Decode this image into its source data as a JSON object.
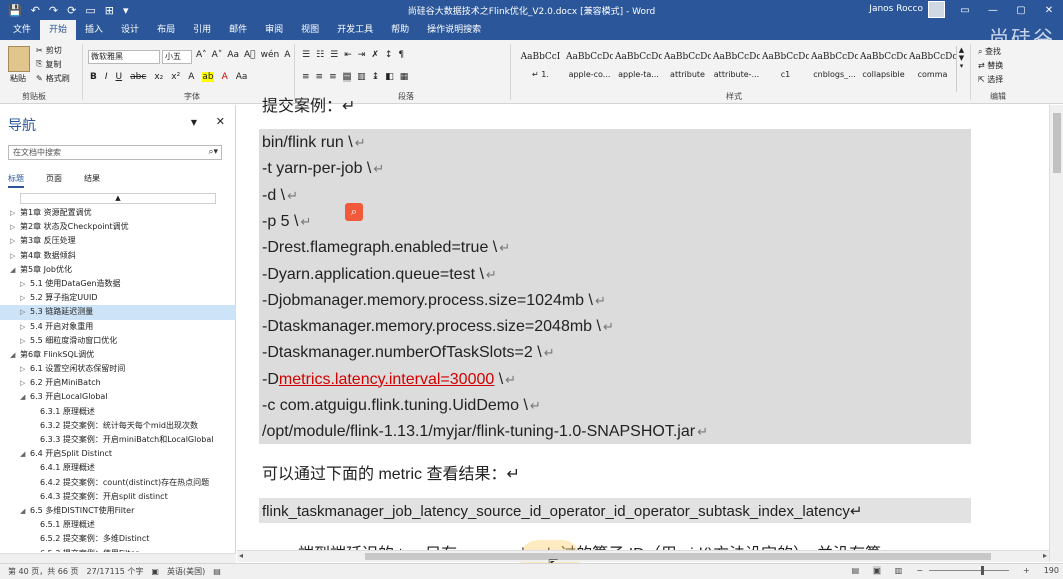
{
  "titlebar": {
    "title": "尚硅谷大数据技术之Flink优化_V2.0.docx [兼容模式] - Word",
    "user": "Janos Rocco",
    "qat": [
      "💾",
      "↶",
      "↷",
      "⟳",
      "▭",
      "⊞",
      "▾"
    ],
    "window_buttons": [
      "▭",
      "—",
      "▢",
      "✕"
    ]
  },
  "tabs": [
    "文件",
    "开始",
    "插入",
    "设计",
    "布局",
    "引用",
    "邮件",
    "审阅",
    "视图",
    "开发工具",
    "帮助",
    "操作说明搜索"
  ],
  "brand": "尚硅谷",
  "ribbon": {
    "clipboard": {
      "paste": "粘贴",
      "cut": "剪切",
      "copy": "复制",
      "format_painter": "格式刷",
      "label": "剪贴板"
    },
    "font": {
      "name": "微软雅黑",
      "size": "小五",
      "label": "字体",
      "row1": [
        "A˄",
        "A˅",
        "Aa",
        "A⃠",
        "wén",
        "A"
      ],
      "row2": [
        "B",
        "I",
        "U",
        "abc",
        "x₂",
        "x²",
        "A",
        "ab",
        "A",
        "Aa"
      ]
    },
    "paragraph": {
      "label": "段落",
      "row1": [
        "☰",
        "☷",
        "☰",
        "⇤",
        "⇥",
        "✗",
        "↕",
        "¶"
      ],
      "row2": [
        "≡",
        "≡",
        "≡",
        "▤",
        "▥",
        "↨",
        "◧",
        "▦"
      ]
    },
    "styles": {
      "label": "样式",
      "items": [
        {
          "sample": "AaBbCcI",
          "name": "↵ 1."
        },
        {
          "sample": "AaBbCcDc",
          "name": "apple-co..."
        },
        {
          "sample": "AaBbCcDc",
          "name": "apple-ta..."
        },
        {
          "sample": "AaBbCcDc",
          "name": "attribute"
        },
        {
          "sample": "AaBbCcDc",
          "name": "attribute-..."
        },
        {
          "sample": "AaBbCcDc",
          "name": "c1"
        },
        {
          "sample": "AaBbCcDc",
          "name": "cnblogs_..."
        },
        {
          "sample": "AaBbCcDc",
          "name": "collapsible"
        },
        {
          "sample": "AaBbCcDc",
          "name": "comma"
        }
      ]
    },
    "editing": {
      "label": "编辑",
      "find": "查找",
      "replace": "替换",
      "select": "选择"
    }
  },
  "nav": {
    "title": "导航",
    "search_placeholder": "在文档中搜索",
    "tabs": [
      "标题",
      "页面",
      "结果"
    ],
    "items": [
      {
        "level": 1,
        "text": "第1章 资源配置调优",
        "selected": false
      },
      {
        "level": 1,
        "text": "第2章 状态及Checkpoint调优",
        "selected": false
      },
      {
        "level": 1,
        "text": "第3章 反压处理",
        "selected": false
      },
      {
        "level": 1,
        "text": "第4章 数据倾斜",
        "selected": false
      },
      {
        "level": 1,
        "text": "第5章 Job优化",
        "selected": false,
        "open": true
      },
      {
        "level": 2,
        "text": "5.1 使用DataGen造数据",
        "selected": false
      },
      {
        "level": 2,
        "text": "5.2 算子指定UUID",
        "selected": false
      },
      {
        "level": 2,
        "text": "5.3 链路延迟测量",
        "selected": true
      },
      {
        "level": 2,
        "text": "5.4 开启对象重用",
        "selected": false
      },
      {
        "level": 2,
        "text": "5.5 细粒度滑动窗口优化",
        "selected": false
      },
      {
        "level": 1,
        "text": "第6章 FlinkSQL调优",
        "selected": false,
        "open": true
      },
      {
        "level": 2,
        "text": "6.1 设置空闲状态保留时间",
        "selected": false
      },
      {
        "level": 2,
        "text": "6.2 开启MiniBatch",
        "selected": false
      },
      {
        "level": 2,
        "text": "6.3 开启LocalGlobal",
        "selected": false,
        "open": true
      },
      {
        "level": 3,
        "text": "6.3.1 原理概述",
        "selected": false
      },
      {
        "level": 3,
        "text": "6.3.2 提交案例：统计每天每个mid出现次数",
        "selected": false
      },
      {
        "level": 3,
        "text": "6.3.3 提交案例：开启miniBatch和LocalGlobal",
        "selected": false
      },
      {
        "level": 2,
        "text": "6.4 开启Split Distinct",
        "selected": false,
        "open": true
      },
      {
        "level": 3,
        "text": "6.4.1 原理概述",
        "selected": false
      },
      {
        "level": 3,
        "text": "6.4.2 提交案例：count(distinct)存在热点问题",
        "selected": false
      },
      {
        "level": 3,
        "text": "6.4.3 提交案例：开启split distinct",
        "selected": false
      },
      {
        "level": 2,
        "text": "6.5 多维DISTINCT使用Filter",
        "selected": false,
        "open": true
      },
      {
        "level": 3,
        "text": "6.5.1 原理概述",
        "selected": false
      },
      {
        "level": 3,
        "text": "6.5.2 提交案例：多维Distinct",
        "selected": false
      },
      {
        "level": 3,
        "text": "6.5.3 提交案例：使用Filter",
        "selected": false
      }
    ]
  },
  "doc": {
    "prev_heading": "提交案例：↵",
    "code_lines": [
      {
        "pre": "bin/flink run \\",
        "red": "",
        "post": ""
      },
      {
        "pre": "-t yarn-per-job \\",
        "red": "",
        "post": ""
      },
      {
        "pre": "-d \\",
        "red": "",
        "post": ""
      },
      {
        "pre": "-p 5 \\",
        "red": "",
        "post": ""
      },
      {
        "pre": "-Drest.flamegraph.enabled=true \\",
        "red": "",
        "post": ""
      },
      {
        "pre": "-Dyarn.application.queue=test \\",
        "red": "",
        "post": ""
      },
      {
        "pre": "-Djobmanager.memory.process.size=1024mb \\",
        "red": "",
        "post": ""
      },
      {
        "pre": "-Dtaskmanager.memory.process.size=2048mb \\",
        "red": "",
        "post": ""
      },
      {
        "pre": "-Dtaskmanager.numberOfTaskSlots=2 \\",
        "red": "",
        "post": ""
      },
      {
        "pre": "-D",
        "red": "metrics.latency.interval=30000",
        "post": " \\"
      },
      {
        "pre": "-c com.atguigu.flink.tuning.UidDemo \\",
        "red": "",
        "post": ""
      },
      {
        "pre": "/opt/module/flink-1.13.1/myjar/flink-tuning-1.0-SNAPSHOT.jar",
        "red": "",
        "post": ""
      }
    ],
    "line_mark": "↵",
    "para1": "可以通过下面的 metric 查看结果：↵",
    "metric": "flink_taskmanager_job_latency_source_id_operator_id_operator_subtask_index_latency↵",
    "para2": "端到端延迟的 tag 只有 murmur hash 过的算子 ID（用 uid()方法设定的），并没有算"
  },
  "status": {
    "page": "第 40 页，共 66 页",
    "words": "27/17115 个字",
    "proof_icon": "▣",
    "lang": "英语(美国)",
    "layout_icon": "▤",
    "zoom": "190",
    "zoom_level": 0.65
  }
}
